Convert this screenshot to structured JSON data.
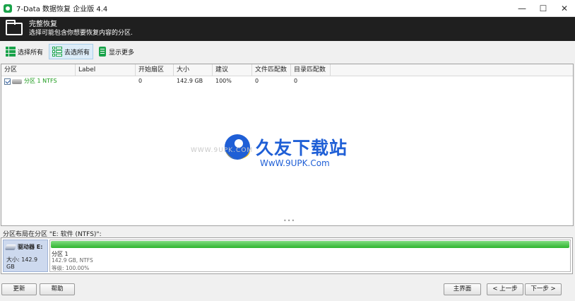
{
  "window": {
    "title": "7-Data 数据恢复 企业版 4.4",
    "minimize": "—",
    "maximize": "☐",
    "close": "✕"
  },
  "header": {
    "title": "完整恢复",
    "subtitle": "选择可能包含你想要恢复内容的分区."
  },
  "toolbar": {
    "select_all": "选择所有",
    "deselect_all": "去选所有",
    "show_more": "显示更多"
  },
  "table": {
    "columns": [
      "分区",
      "Label",
      "开始扇区",
      "大小",
      "建议",
      "文件匹配数",
      "目录匹配数"
    ],
    "rows": [
      {
        "checked": true,
        "partition": "分区 1 NTFS",
        "label": "",
        "start": "0",
        "size": "142.9 GB",
        "suggest": "100%",
        "file_match": "0",
        "dir_match": "0"
      }
    ]
  },
  "watermark": {
    "brand": "久友下载站",
    "site": "WwW.9UPK.Com",
    "url": "WWW.9UPK.COM"
  },
  "layout": {
    "label": "分区布局在分区 \"E: 软件 (NTFS)\":",
    "drive_title": "驱动器 E:",
    "drive_size": "大小: 142.9 GB",
    "partition_name": "分区 1",
    "partition_info": "142.9 GB, NTFS",
    "partition_level": "等级: 100.00%",
    "fill_fraction": 1.0
  },
  "buttons": {
    "refresh": "更新",
    "help": "帮助",
    "home": "主界面",
    "back": "< 上一步",
    "next": "下一步 >"
  },
  "colors": {
    "accent": "#1aa34a",
    "header_bg": "#1f1f1f",
    "watermark_blue": "#1f5fd6"
  }
}
